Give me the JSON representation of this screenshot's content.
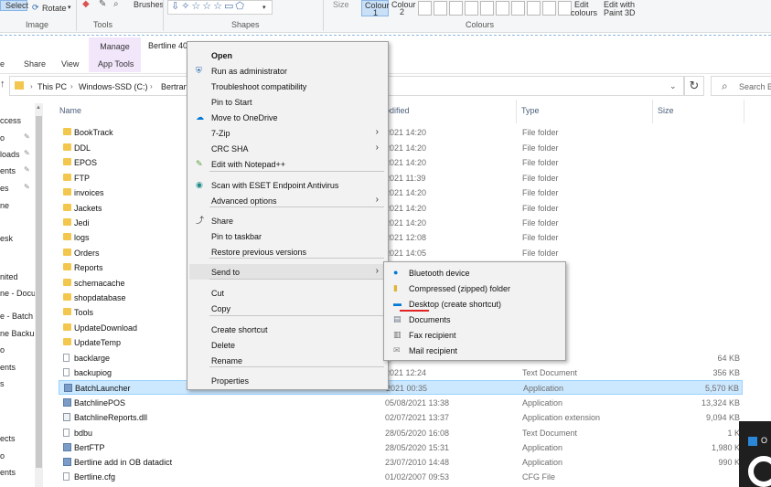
{
  "paint_ribbon": {
    "select_label": "Select",
    "rotate_label": "Rotate",
    "brushes_label": "Brushes",
    "size_label": "Size",
    "colour1_label": "Colour\n1",
    "colour1_top": "Colour",
    "colour1_bottom": "1",
    "colour2_top": "Colour",
    "colour2_bottom": "2",
    "edit_colours_top": "Edit",
    "edit_colours_bottom": "colours",
    "edit_paint3d_top": "Edit with",
    "edit_paint3d_bottom": "Paint 3D",
    "groups": {
      "image": "Image",
      "tools": "Tools",
      "shapes": "Shapes",
      "colours": "Colours"
    }
  },
  "explorer": {
    "manage_tab": "Manage",
    "title": "Bertline 40",
    "tabs": {
      "share": "Share",
      "view": "View",
      "app_tools": "App Tools"
    },
    "address": {
      "this_pc": "This PC",
      "drive": "Windows-SSD (C:)",
      "folder": "Bertran"
    },
    "search_placeholder": "Search B"
  },
  "nav_pane": {
    "items": [
      "ccess",
      "o",
      "loads",
      "ents",
      "es",
      "ne",
      "esk",
      "nited",
      "ne - Docu",
      "e - Batch",
      "ne Backu",
      "o",
      "ents",
      "s",
      "ects",
      "o",
      "ents"
    ]
  },
  "columns": {
    "name": "Name",
    "modified": "odified",
    "type": "Type",
    "size": "Size"
  },
  "rows": [
    {
      "name": "BookTrack",
      "date": "2021 14:20",
      "type": "File folder",
      "size": "",
      "icon": "folder-icon"
    },
    {
      "name": "DDL",
      "date": "2021 14:20",
      "type": "File folder",
      "size": "",
      "icon": "folder-icon"
    },
    {
      "name": "EPOS",
      "date": "2021 14:20",
      "type": "File folder",
      "size": "",
      "icon": "folder-icon"
    },
    {
      "name": "FTP",
      "date": "2021 11:39",
      "type": "File folder",
      "size": "",
      "icon": "folder-icon"
    },
    {
      "name": "invoices",
      "date": "2021 14:20",
      "type": "File folder",
      "size": "",
      "icon": "folder-icon"
    },
    {
      "name": "Jackets",
      "date": "2021 14:20",
      "type": "File folder",
      "size": "",
      "icon": "folder-icon"
    },
    {
      "name": "Jedi",
      "date": "2021 14:20",
      "type": "File folder",
      "size": "",
      "icon": "folder-icon"
    },
    {
      "name": "logs",
      "date": "2021 12:08",
      "type": "File folder",
      "size": "",
      "icon": "folder-icon"
    },
    {
      "name": "Orders",
      "date": "2021 14:05",
      "type": "File folder",
      "size": "",
      "icon": "folder-icon"
    },
    {
      "name": "Reports",
      "date": "",
      "type": "",
      "size": "",
      "icon": "folder-icon"
    },
    {
      "name": "schemacache",
      "date": "",
      "type": "",
      "size": "",
      "icon": "folder-icon"
    },
    {
      "name": "shopdatabase",
      "date": "",
      "type": "",
      "size": "",
      "icon": "folder-icon"
    },
    {
      "name": "Tools",
      "date": "",
      "type": "",
      "size": "",
      "icon": "folder-icon"
    },
    {
      "name": "UpdateDownload",
      "date": "",
      "type": "",
      "size": "",
      "icon": "folder-icon"
    },
    {
      "name": "UpdateTemp",
      "date": "",
      "type": "",
      "size": "",
      "icon": "folder-icon"
    },
    {
      "name": "backlarge",
      "date": "",
      "type": "",
      "size": "64 KB",
      "icon": "image-file-icon"
    },
    {
      "name": "backupiog",
      "date": "2021 12:24",
      "type": "Text Document",
      "size": "356 KB",
      "icon": "text-file-icon"
    },
    {
      "name": "BatchLauncher",
      "date": "2021 00:35",
      "type": "Application",
      "size": "5,570 KB",
      "icon": "app-icon",
      "selected": true
    },
    {
      "name": "BatchlinePOS",
      "date": "05/08/2021 13:38",
      "type": "Application",
      "size": "13,324 KB",
      "icon": "app-icon"
    },
    {
      "name": "BatchlineReports.dll",
      "date": "02/07/2021 13:37",
      "type": "Application extension",
      "size": "9,094 KB",
      "icon": "dll-icon"
    },
    {
      "name": "bdbu",
      "date": "28/05/2020 16:08",
      "type": "Text Document",
      "size": "1 K",
      "icon": "text-file-icon"
    },
    {
      "name": "BertFTP",
      "date": "28/05/2020 15:31",
      "type": "Application",
      "size": "1,980 K",
      "icon": "app-icon"
    },
    {
      "name": "Bertline add in OB datadict",
      "date": "23/07/2010 14:48",
      "type": "Application",
      "size": "990 K",
      "icon": "app-icon"
    },
    {
      "name": "Bertline.cfg",
      "date": "01/02/2007 09:53",
      "type": "CFG File",
      "size": "",
      "icon": "text-file-icon"
    }
  ],
  "context_menu": {
    "items": [
      {
        "label": "Open",
        "bold": true,
        "icon": ""
      },
      {
        "label": "Run as administrator",
        "icon": "shield-icon"
      },
      {
        "label": "Troubleshoot compatibility",
        "icon": ""
      },
      {
        "label": "Pin to Start",
        "icon": ""
      },
      {
        "label": "Move to OneDrive",
        "icon": "onedrive-icon"
      },
      {
        "label": "7-Zip",
        "icon": "",
        "submenu": true
      },
      {
        "label": "CRC SHA",
        "icon": "",
        "submenu": true
      },
      {
        "label": "Edit with Notepad++",
        "icon": "notepadpp-icon"
      },
      {
        "label": "Scan with ESET Endpoint Antivirus",
        "icon": "eset-icon"
      },
      {
        "label": "Advanced options",
        "icon": "",
        "submenu": true
      },
      {
        "label": "Share",
        "icon": "share-icon"
      },
      {
        "label": "Pin to taskbar",
        "icon": ""
      },
      {
        "label": "Restore previous versions",
        "icon": ""
      },
      {
        "label": "Send to",
        "icon": "",
        "submenu": true,
        "highlighted": true
      },
      {
        "label": "Cut",
        "icon": ""
      },
      {
        "label": "Copy",
        "icon": ""
      },
      {
        "label": "Create shortcut",
        "icon": ""
      },
      {
        "label": "Delete",
        "icon": ""
      },
      {
        "label": "Rename",
        "icon": ""
      },
      {
        "label": "Properties",
        "icon": ""
      }
    ]
  },
  "sendto_menu": {
    "items": [
      {
        "label": "Bluetooth device",
        "icon": "bluetooth-icon"
      },
      {
        "label": "Compressed (zipped) folder",
        "icon": "zip-folder-icon"
      },
      {
        "label": "Desktop (create shortcut)",
        "icon": "desktop-icon"
      },
      {
        "label": "Documents",
        "icon": "documents-icon"
      },
      {
        "label": "Fax recipient",
        "icon": "fax-icon"
      },
      {
        "label": "Mail recipient",
        "icon": "mail-icon"
      }
    ]
  },
  "toast": {
    "text": "O"
  },
  "colors": {
    "accent": "#0078d7",
    "selection": "#cce8ff",
    "folder": "#f3c74e",
    "manage_tab": "#f2e6fb"
  }
}
